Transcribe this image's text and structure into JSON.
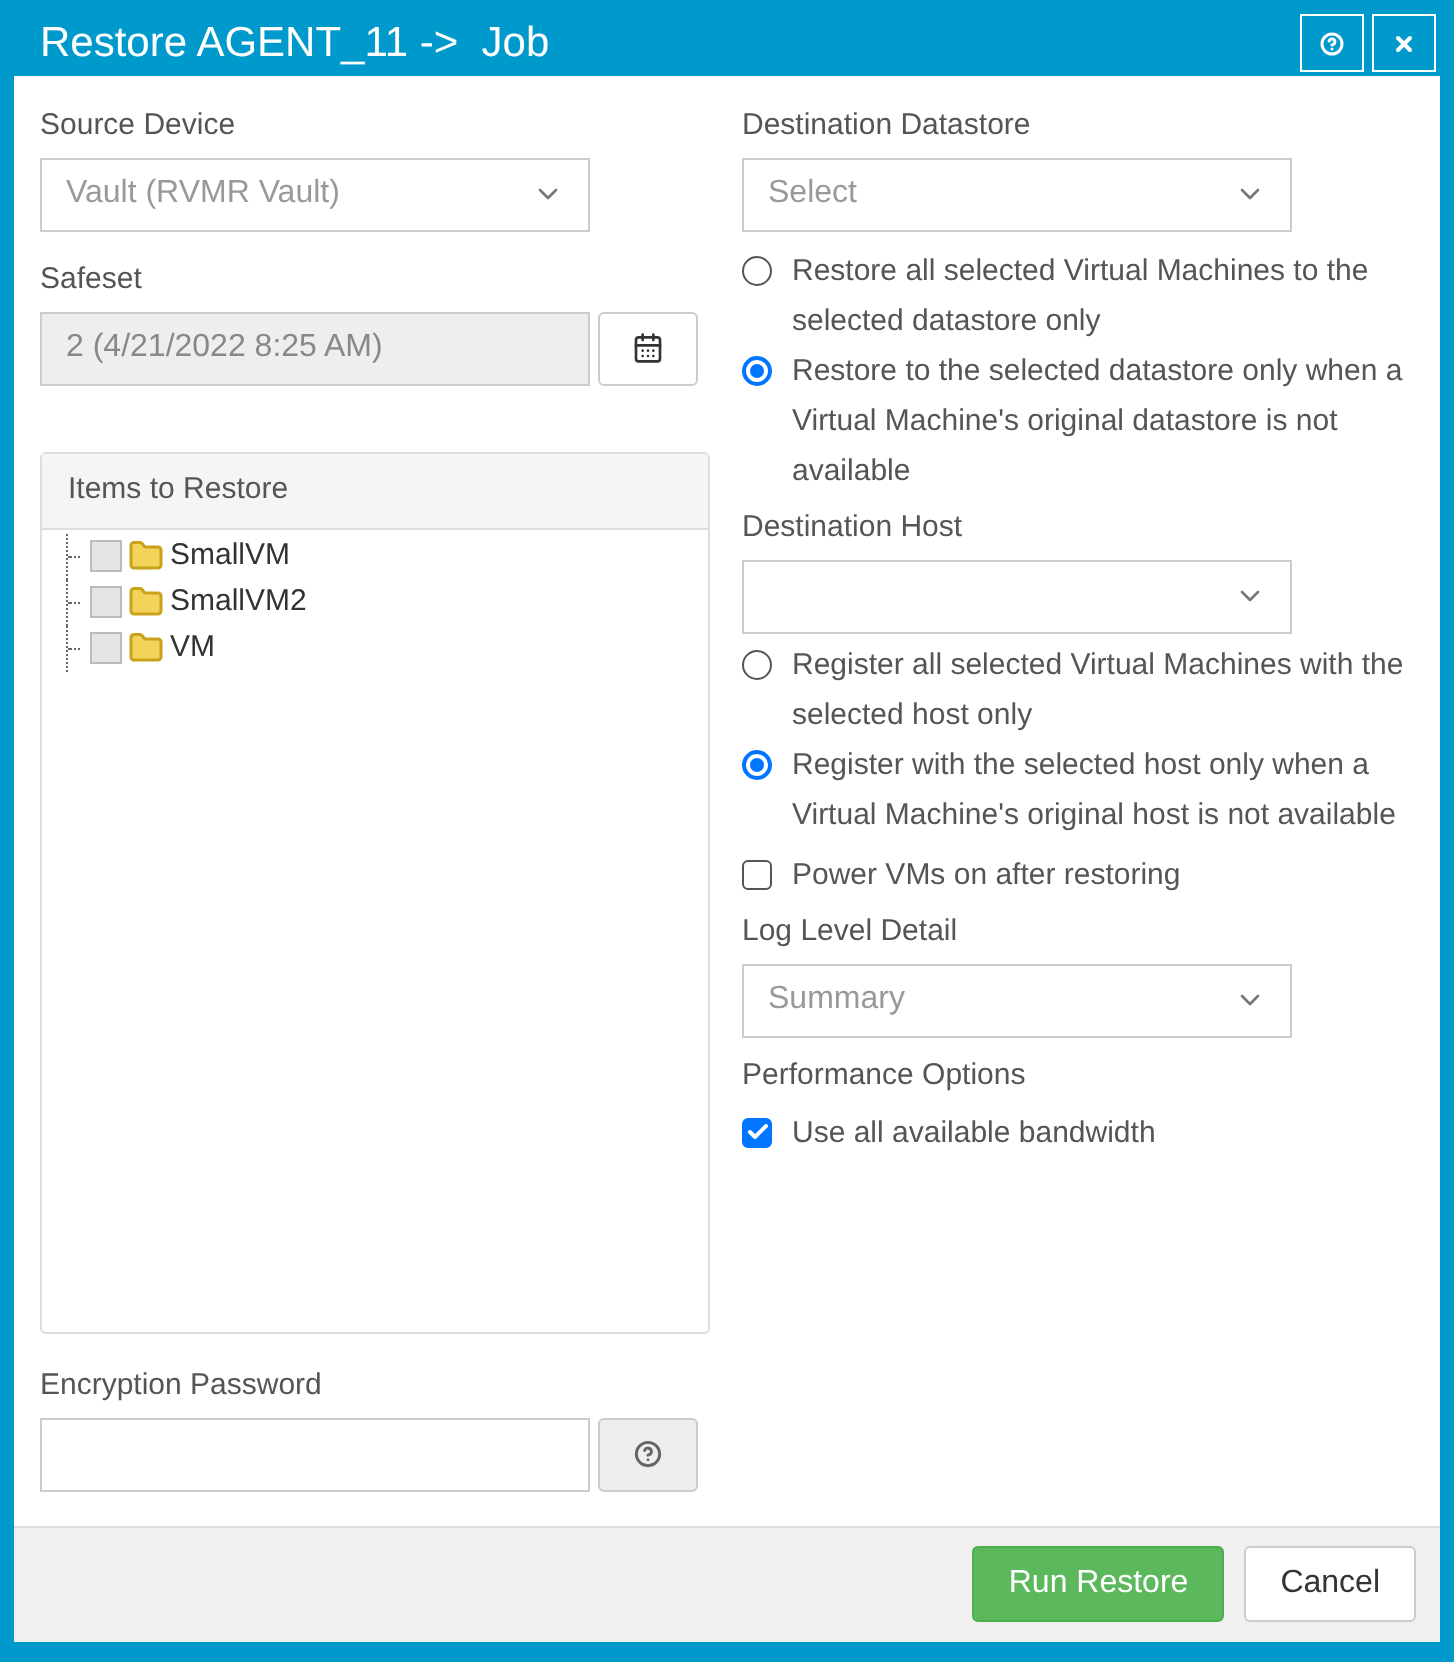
{
  "window": {
    "title": "Restore AGENT_11 ->  Job"
  },
  "left": {
    "source_device": {
      "label": "Source Device",
      "value": "Vault (RVMR Vault)"
    },
    "safeset": {
      "label": "Safeset",
      "value": "2 (4/21/2022 8:25 AM)",
      "disabled": true
    },
    "items_panel": {
      "title": "Items to Restore",
      "items": [
        {
          "label": "SmallVM",
          "checked": false
        },
        {
          "label": "SmallVM2",
          "checked": false
        },
        {
          "label": "VM",
          "checked": false
        }
      ]
    },
    "encryption_password": {
      "label": "Encryption Password"
    }
  },
  "right": {
    "destination_datastore": {
      "label": "Destination Datastore",
      "value": "Select",
      "options": [
        {
          "label": "Restore all selected Virtual Machines to the selected datastore only",
          "selected": false
        },
        {
          "label": "Restore to the selected datastore only when a Virtual Machine's original datastore is not available",
          "selected": true
        }
      ]
    },
    "destination_host": {
      "label": "Destination Host",
      "options": [
        {
          "label": "Register all selected Virtual Machines with the selected host only",
          "selected": false
        },
        {
          "label": "Register with the selected host only when a Virtual Machine's original host is not available",
          "selected": true
        }
      ]
    },
    "power_on": {
      "label": "Power VMs on after restoring",
      "checked": false
    },
    "log_level": {
      "label": "Log Level Detail",
      "value": "Summary"
    },
    "performance": {
      "label": "Performance Options",
      "options": [
        {
          "label": "Use all available bandwidth",
          "checked": true
        }
      ]
    }
  },
  "buttons": [
    {
      "label": "Run Restore",
      "kind": "primary"
    },
    {
      "label": "Cancel",
      "kind": "default"
    }
  ]
}
